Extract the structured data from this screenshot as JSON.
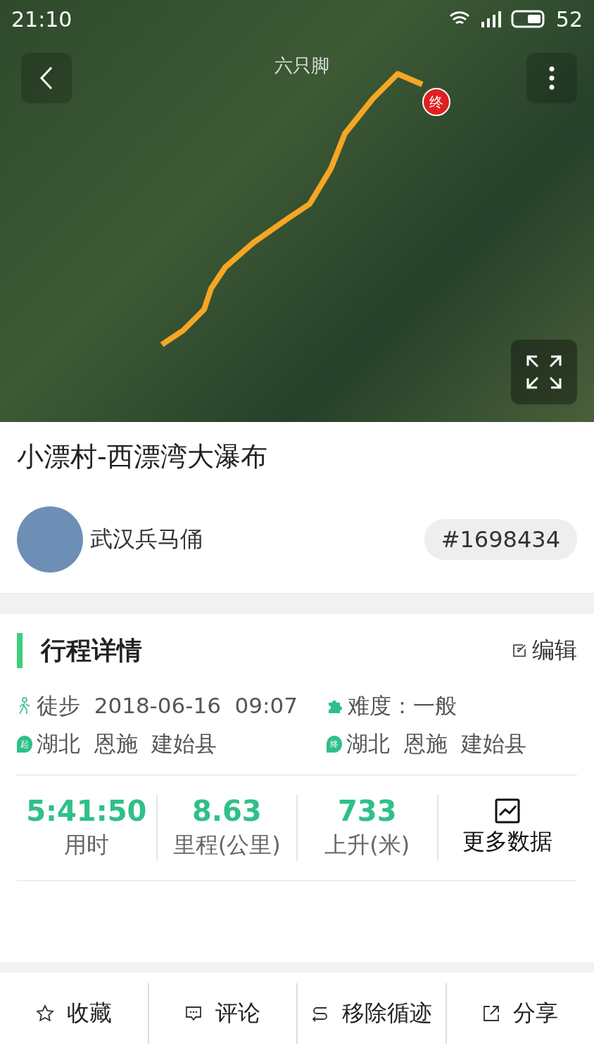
{
  "status_bar": {
    "time": "21:10",
    "battery": "52"
  },
  "map": {
    "logo": "六只脚",
    "end_marker": "终"
  },
  "title": "小漂村-西漂湾大瀑布",
  "author": {
    "name": "武汉兵马俑",
    "track_id": "#1698434"
  },
  "details": {
    "heading": "行程详情",
    "edit": "编辑",
    "info": [
      {
        "kind": "walk",
        "text": "徒步  2018-06-16  09:07"
      },
      {
        "kind": "difficulty",
        "text": "难度：一般"
      },
      {
        "kind": "start",
        "badge": "起",
        "text": "湖北  恩施  建始县"
      },
      {
        "kind": "end",
        "badge": "终",
        "text": "湖北  恩施  建始县"
      }
    ],
    "stats": [
      {
        "value": "5:41:50",
        "label": "用时"
      },
      {
        "value": "8.63",
        "label": "里程(公里)"
      },
      {
        "value": "733",
        "label": "上升(米)"
      }
    ],
    "more": "更多数据"
  },
  "actions": [
    {
      "kind": "star",
      "label": "收藏"
    },
    {
      "kind": "comment",
      "label": "评论"
    },
    {
      "kind": "remove",
      "label": "移除循迹"
    },
    {
      "kind": "share",
      "label": "分享"
    }
  ]
}
